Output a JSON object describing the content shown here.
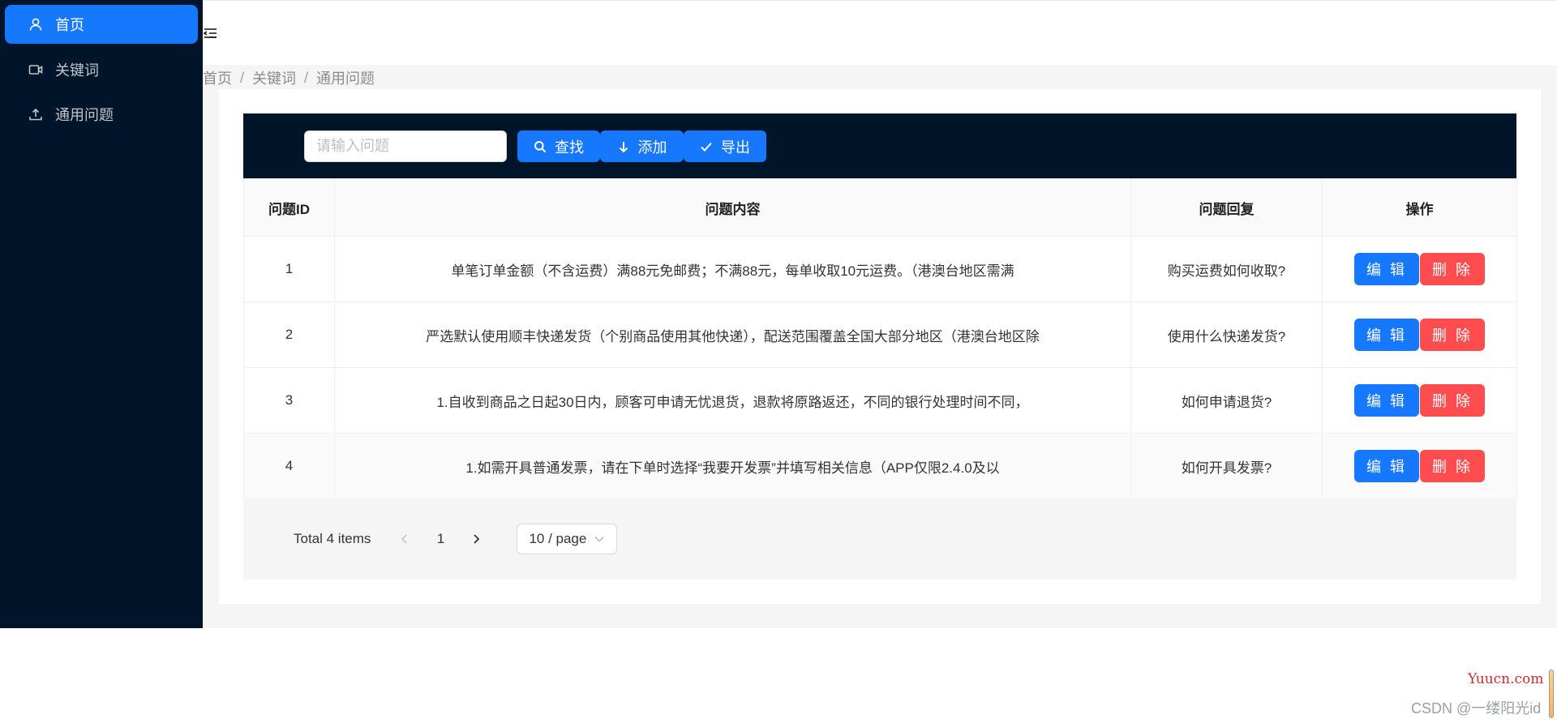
{
  "sidebar": {
    "items": [
      {
        "label": "首页",
        "icon": "user-icon",
        "active": true
      },
      {
        "label": "关键词",
        "icon": "video-camera-icon",
        "active": false
      },
      {
        "label": "通用问题",
        "icon": "upload-icon",
        "active": false
      }
    ]
  },
  "header": {
    "fold_icon": "menu-fold-icon"
  },
  "breadcrumb": [
    "首页",
    "关键词",
    "通用问题"
  ],
  "toolbar": {
    "search_placeholder": "请输入问题",
    "search_value": "",
    "find_label": "查找",
    "add_label": "添加",
    "export_label": "导出"
  },
  "table": {
    "columns": [
      "问题ID",
      "问题内容",
      "问题回复",
      "操作"
    ],
    "rows": [
      {
        "id": "1",
        "content": "单笔订单金额（不含运费）满88元免邮费；不满88元，每单收取10元运费。（港澳台地区需满",
        "reply": "购买运费如何收取?"
      },
      {
        "id": "2",
        "content": "严选默认使用顺丰快递发货（个别商品使用其他快递），配送范围覆盖全国大部分地区（港澳台地区除",
        "reply": "使用什么快递发货?"
      },
      {
        "id": "3",
        "content": "1.自收到商品之日起30日内，顾客可申请无忧退货，退款将原路返还，不同的银行处理时间不同，",
        "reply": "如何申请退货?"
      },
      {
        "id": "4",
        "content": "1.如需开具普通发票，请在下单时选择“我要开发票”并填写相关信息（APP仅限2.4.0及以",
        "reply": "如何开具发票?"
      }
    ],
    "edit_label": "编 辑",
    "delete_label": "删 除"
  },
  "pagination": {
    "total_text": "Total 4 items",
    "current_page": "1",
    "page_size": "10 / page"
  },
  "watermark": {
    "site": "Yuucn.com",
    "author": "CSDN @一缕阳光id"
  },
  "colors": {
    "sidebar_bg": "#001529",
    "primary": "#1677ff",
    "danger": "#ff4d4f"
  }
}
